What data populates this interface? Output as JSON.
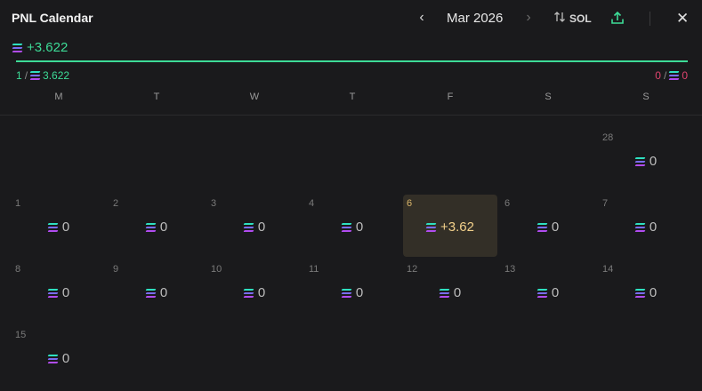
{
  "header": {
    "title": "PNL Calendar",
    "month": "Mar 2026",
    "prev": "‹",
    "next": "›",
    "currency": "SOL",
    "close": "✕"
  },
  "summary": {
    "total": "+3.622",
    "win_count": "1",
    "win_amount": "3.622",
    "loss_count": "0",
    "loss_amount": "0",
    "slash": "/"
  },
  "weekdays": [
    "M",
    "T",
    "W",
    "T",
    "F",
    "S",
    "S"
  ],
  "days": [
    {
      "day": "28",
      "pnl": "0"
    },
    {
      "day": "1",
      "pnl": "0"
    },
    {
      "day": "2",
      "pnl": "0"
    },
    {
      "day": "3",
      "pnl": "0"
    },
    {
      "day": "4",
      "pnl": "0"
    },
    {
      "day": "6",
      "pnl": "+3.62"
    },
    {
      "day": "6",
      "pnl": "0"
    },
    {
      "day": "7",
      "pnl": "0"
    },
    {
      "day": "8",
      "pnl": "0"
    },
    {
      "day": "9",
      "pnl": "0"
    },
    {
      "day": "10",
      "pnl": "0"
    },
    {
      "day": "11",
      "pnl": "0"
    },
    {
      "day": "12",
      "pnl": "0"
    },
    {
      "day": "13",
      "pnl": "0"
    },
    {
      "day": "14",
      "pnl": "0"
    },
    {
      "day": "15",
      "pnl": "0"
    }
  ],
  "colors": {
    "background": "#1a1a1c",
    "positive": "#3ddc97",
    "negative": "#e0446e",
    "highlight_bg": "#332f27",
    "highlight_text": "#f2d08a"
  },
  "icons": {
    "currency": "solana-icon",
    "swap": "swap-arrows-icon",
    "share": "upload-share-icon"
  }
}
